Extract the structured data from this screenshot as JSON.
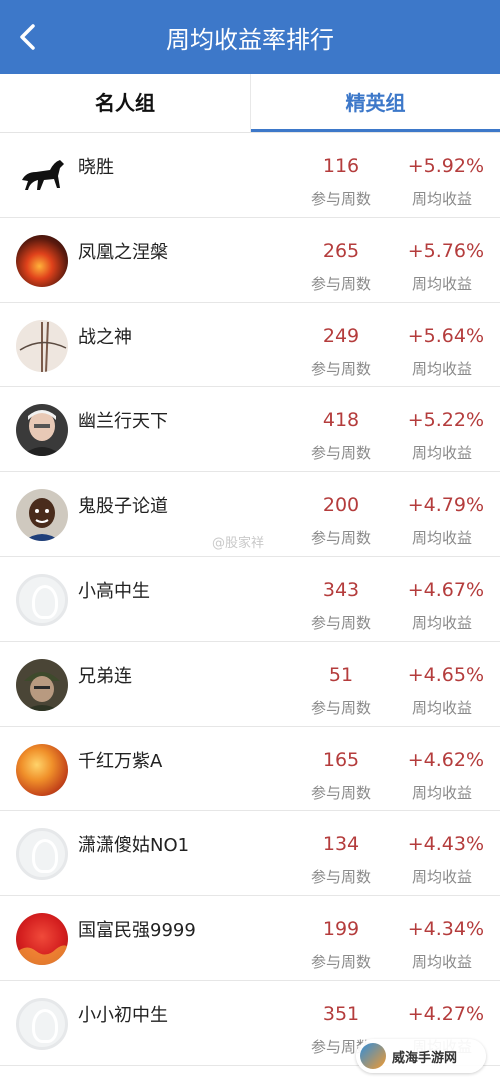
{
  "header": {
    "title": "周均收益率排行",
    "back_icon": "chevron-left-icon"
  },
  "tabs": [
    {
      "label": "名人组",
      "active": false
    },
    {
      "label": "精英组",
      "active": true
    }
  ],
  "columns": {
    "weeks_label": "参与周数",
    "rate_label": "周均收益"
  },
  "rows": [
    {
      "name": "晓胜",
      "weeks": "116",
      "rate": "+5.92%",
      "avatar": "horse-image"
    },
    {
      "name": "凤凰之涅槃",
      "weeks": "265",
      "rate": "+5.76%",
      "avatar": "phoenix-fire-image"
    },
    {
      "name": "战之神",
      "weeks": "249",
      "rate": "+5.64%",
      "avatar": "ferris-wheel-image"
    },
    {
      "name": "幽兰行天下",
      "weeks": "418",
      "rate": "+5.22%",
      "avatar": "old-man-photo"
    },
    {
      "name": "鬼股子论道",
      "weeks": "200",
      "rate": "+4.79%",
      "avatar": "child-photo"
    },
    {
      "name": "小高中生",
      "weeks": "343",
      "rate": "+4.67%",
      "avatar": "default-user-avatar"
    },
    {
      "name": "兄弟连",
      "weeks": "51",
      "rate": "+4.65%",
      "avatar": "soldier-photo"
    },
    {
      "name": "千红万紫A",
      "weeks": "165",
      "rate": "+4.62%",
      "avatar": "flowers-image"
    },
    {
      "name": "潇潇傻姑NO1",
      "weeks": "134",
      "rate": "+4.43%",
      "avatar": "default-user-avatar"
    },
    {
      "name": "国富民强9999",
      "weeks": "199",
      "rate": "+4.34%",
      "avatar": "red-flag-image"
    },
    {
      "name": "小小初中生",
      "weeks": "351",
      "rate": "+4.27%",
      "avatar": "default-user-avatar"
    }
  ],
  "watermark": "@股家祥",
  "site_badge": "威海手游网",
  "colors": {
    "accent": "#3d78c9",
    "rate": "#b43c3c",
    "label": "#8a8a8a"
  }
}
